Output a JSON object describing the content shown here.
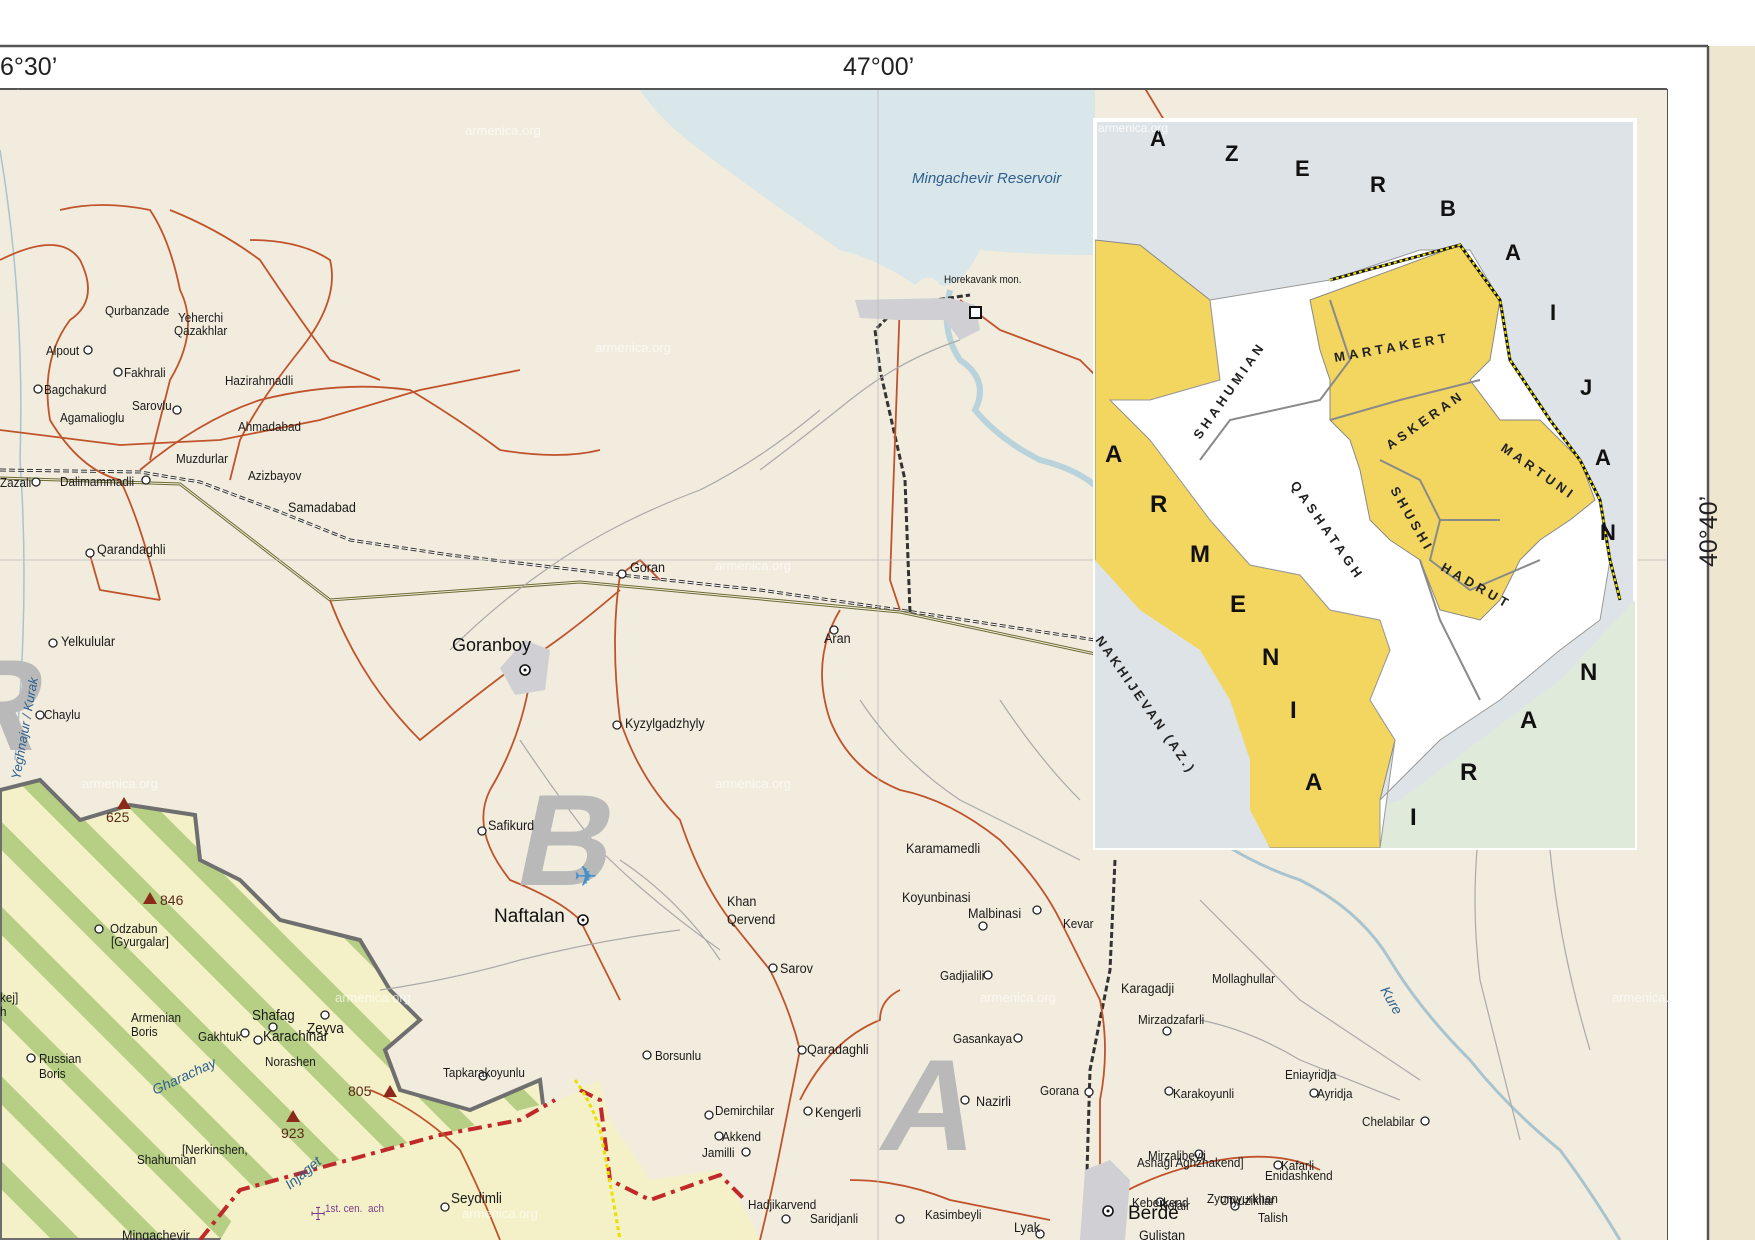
{
  "grid": {
    "top": [
      "6°30’",
      "47°00’"
    ],
    "right": [
      "40°40’"
    ]
  },
  "water": [
    {
      "id": "mingachevir-reservoir",
      "label": "Mingachevir Reservoir"
    },
    {
      "id": "kure",
      "label": "Kure"
    },
    {
      "id": "gharachay",
      "label": "Gharachay"
    },
    {
      "id": "injaget",
      "label": "Injaget"
    },
    {
      "id": "yeghnajur",
      "label": "Yeghnajur / Kurak"
    }
  ],
  "towns_major": [
    {
      "id": "goranboy",
      "label": "Goranboy"
    },
    {
      "id": "naftalan",
      "label": "Naftalan"
    },
    {
      "id": "berde",
      "label": "Berde"
    }
  ],
  "places": [
    "Qurbanzade",
    "Yeherchi",
    "Qazakhlar",
    "Alpout",
    "Fakhrali",
    "Hazirahmadli",
    "Bagchakurd",
    "Sarovlu",
    "Agamalioglu",
    "Ahmadabad",
    "Muzdurlar",
    "Azizbayov",
    "Zazali",
    "Dalimammadli",
    "Samadabad",
    "Qarandaghli",
    "Goran",
    "Aran",
    "Yelkulular",
    "Chaylu",
    "Kyzylgadzhyly",
    "Safikurd",
    "Khan",
    "Qervend",
    "Karamamedli",
    "Koyunbinasi",
    "Malbinasi",
    "Kevar",
    "Sarov",
    "Gadjialili",
    "Karagadji",
    "Mollaghullar",
    "Mirzadzafarli",
    "Gasankaya",
    "Odzabun",
    "[Gyurgalar]",
    "Armenian",
    "Boris",
    "Shafag",
    "Zeyva",
    "Gakhtuk",
    "Karachinar",
    "Norashen",
    "Russian",
    "Boris",
    "Tapkarakoyunlu",
    "Borsunlu",
    "Qaradaghli",
    "Kengerli",
    "Demirchilar",
    "Akkend",
    "Jamilli",
    "Nazirli",
    "Gorana",
    "Karakoyunli",
    "Eniayridja",
    "Ayridja",
    "Chelabilar",
    "Shahumian",
    "[Nerkinshen,",
    "Ashagi Aghzhakend]",
    "Mirzalibeyli",
    "Kafarli",
    "Enidashkend",
    "Zyumyurkhan",
    "Otyuzikilar",
    "Keberkend",
    "Kolair",
    "Talish",
    "Seydimli",
    "Hadjikarvend",
    "Saridjanli",
    "Kasimbeyli",
    "Lyak",
    "Gulistan",
    "Mingachevir",
    "Horekavank mon.",
    "1st. cen.",
    "ach",
    "kej]",
    "h"
  ],
  "peaks": [
    "625",
    "846",
    "805",
    "923"
  ],
  "region_letters": [
    "R",
    "B",
    "A"
  ],
  "inset": {
    "labels": {
      "azerbaijan": [
        "A",
        "Z",
        "E",
        "R",
        "B",
        "A",
        "I",
        "J",
        "A",
        "N"
      ],
      "armenia": [
        "A",
        "R",
        "M",
        "E",
        "N",
        "I",
        "A"
      ],
      "iran": [
        "I",
        "R",
        "A",
        "N"
      ],
      "nakhijevan": "NAKHIJEVAN (AZ.)",
      "districts": [
        "SHAHUMIAN",
        "MARTAKERT",
        "ASKERAN",
        "MARTUNI",
        "SHUSHI",
        "QASHATAGH",
        "HADRUT"
      ]
    }
  },
  "watermark": "armenica.org",
  "colors": {
    "land": "#f1ecdd",
    "water": "#d9e6ea",
    "roads": "#c0532c",
    "armenian_zone": "#f4f1c9",
    "stripe": "#b6cf84",
    "inset_yellow": "#f2d660",
    "inset_gray": "#dde3e6",
    "inset_iran": "#dfeadb",
    "border_dark": "#444444"
  }
}
